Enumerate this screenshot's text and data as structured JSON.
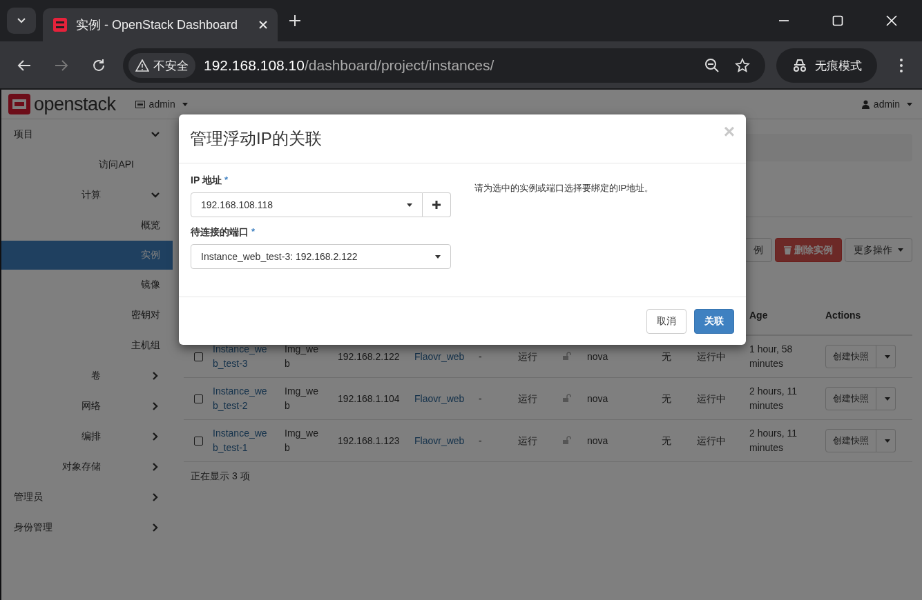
{
  "browser": {
    "tab_title": "实例 - OpenStack Dashboard",
    "security_label": "不安全",
    "url_host": "192.168.108.10",
    "url_path": "/dashboard/project/instances/",
    "incognito_label": "无痕模式"
  },
  "navbar": {
    "logo_text": "openstack",
    "project_menu": "admin",
    "user_menu": "admin"
  },
  "sidebar": {
    "items": [
      {
        "label": "项目",
        "expanded": true,
        "children": [
          {
            "label": "访问API",
            "selected": false
          },
          {
            "label": "计算",
            "expanded": true,
            "children": [
              {
                "label": "概览",
                "selected": false
              },
              {
                "label": "实例",
                "selected": true
              },
              {
                "label": "镜像",
                "selected": false
              },
              {
                "label": "密钥对",
                "selected": false
              },
              {
                "label": "主机组",
                "selected": false
              }
            ]
          },
          {
            "label": "卷",
            "expanded": false
          },
          {
            "label": "网络",
            "expanded": false
          },
          {
            "label": "编排",
            "expanded": false
          },
          {
            "label": "对象存储",
            "expanded": false
          }
        ]
      },
      {
        "label": "管理员",
        "expanded": false
      },
      {
        "label": "身份管理",
        "expanded": false
      }
    ]
  },
  "toolbar": {
    "buttons": [
      {
        "label": "例",
        "kind": "default"
      },
      {
        "label": "删除实例",
        "kind": "danger"
      },
      {
        "label": "更多操作",
        "kind": "dropdown"
      }
    ]
  },
  "table": {
    "columns": [
      "Age",
      "Actions"
    ],
    "rows": [
      {
        "name": "Instance_web_test-3",
        "image": "Img_web",
        "ip": "192.168.2.122",
        "flavor": "Flaovr_web",
        "key_pair": "-",
        "status": "运行",
        "az": "nova",
        "task": "无",
        "power": "运行中",
        "age": "1 hour, 58 minutes",
        "action": "创建快照",
        "checked": false
      },
      {
        "name": "Instance_web_test-2",
        "image": "Img_web",
        "ip": "192.168.1.104",
        "flavor": "Flaovr_web",
        "key_pair": "-",
        "status": "运行",
        "az": "nova",
        "task": "无",
        "power": "运行中",
        "age": "2 hours, 11 minutes",
        "action": "创建快照",
        "checked": false
      },
      {
        "name": "Instance_web_test-1",
        "image": "Img_web",
        "ip": "192.168.1.123",
        "flavor": "Flaovr_web",
        "key_pair": "-",
        "status": "运行",
        "az": "nova",
        "task": "无",
        "power": "运行中",
        "age": "2 hours, 11 minutes",
        "action": "创建快照",
        "checked": false
      }
    ],
    "footer": "正在显示 3 项"
  },
  "modal": {
    "title": "管理浮动IP的关联",
    "close": "×",
    "required_mark": "*",
    "fields": [
      {
        "label": "IP 地址",
        "required": true,
        "value": "192.168.108.118",
        "has_add": true
      },
      {
        "label": "待连接的端口",
        "required": true,
        "value": "Instance_web_test-3: 192.168.2.122",
        "has_add": false
      }
    ],
    "help": "请为选中的实例或端口选择要绑定的IP地址。",
    "buttons": [
      {
        "label": "取消",
        "kind": "default"
      },
      {
        "label": "关联",
        "kind": "primary"
      }
    ]
  }
}
